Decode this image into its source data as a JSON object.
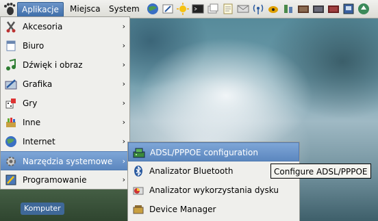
{
  "panel": {
    "applications_label": "Aplikacje",
    "places_label": "Miejsca",
    "system_label": "System",
    "launchers": [
      "globe-icon",
      "edit-icon",
      "weather-icon",
      "terminal-icon",
      "file-manager-icon",
      "text-editor-icon",
      "mail-icon",
      "network-icon",
      "music-icon",
      "tools-icon",
      "film-icon",
      "film-icon",
      "video-icon",
      "system-settings-icon",
      "update-icon"
    ]
  },
  "menu": {
    "items": [
      {
        "label": "Akcesoria",
        "icon": "accessories-icon",
        "arrow": "›"
      },
      {
        "label": "Biuro",
        "icon": "office-icon",
        "arrow": "›"
      },
      {
        "label": "Dźwięk i obraz",
        "icon": "sound-video-icon",
        "arrow": "›"
      },
      {
        "label": "Grafika",
        "icon": "graphics-icon",
        "arrow": "›"
      },
      {
        "label": "Gry",
        "icon": "games-icon",
        "arrow": "›"
      },
      {
        "label": "Inne",
        "icon": "other-icon",
        "arrow": "›"
      },
      {
        "label": "Internet",
        "icon": "internet-icon",
        "arrow": "›"
      },
      {
        "label": "Narzędzia systemowe",
        "icon": "system-tools-icon",
        "arrow": "›"
      },
      {
        "label": "Programowanie",
        "icon": "programming-icon",
        "arrow": "›"
      }
    ]
  },
  "submenu": {
    "items": [
      {
        "label": "ADSL/PPPOE configuration",
        "icon": "adsl-icon"
      },
      {
        "label": "Analizator Bluetooth",
        "icon": "bluetooth-icon"
      },
      {
        "label": "Analizator wykorzystania dysku",
        "icon": "disk-usage-icon"
      },
      {
        "label": "Device Manager",
        "icon": "device-manager-icon"
      }
    ]
  },
  "tooltip": {
    "text": "Configure ADSL/PPPOE"
  },
  "desktop": {
    "icon_label": "Komputer"
  },
  "colors": {
    "highlight": "#5c87bf",
    "panel": "#dcdcd6",
    "menu_bg": "#efefec"
  }
}
